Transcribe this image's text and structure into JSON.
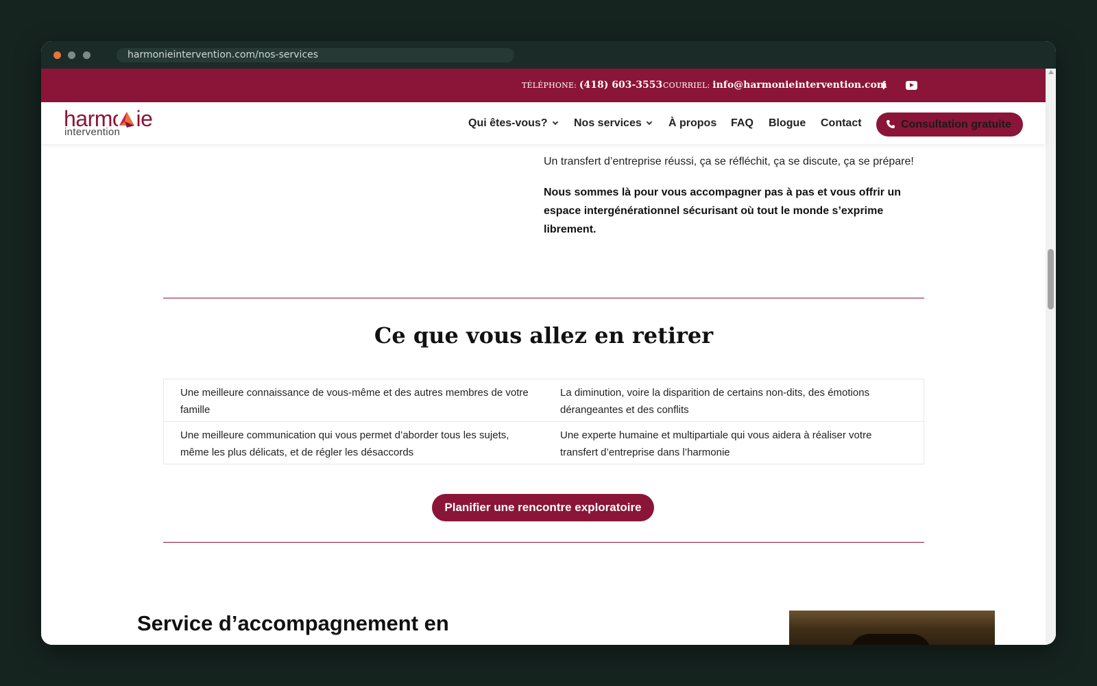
{
  "browser": {
    "url": "harmonieintervention.com/nos-services"
  },
  "topbar": {
    "phone_label": "TÉLÉPHONE:",
    "phone_value": "(418) 603-3553",
    "email_label": "COURRIEL:",
    "email_value": "info@harmonieintervention.com",
    "social_icons": [
      "facebook-icon",
      "youtube-icon"
    ]
  },
  "header": {
    "logo_top": "harmonie",
    "logo_bottom": "intervention",
    "nav": [
      {
        "label": "Qui êtes-vous?",
        "has_dropdown": true
      },
      {
        "label": "Nos services",
        "has_dropdown": true
      },
      {
        "label": "À propos",
        "has_dropdown": false
      },
      {
        "label": "FAQ",
        "has_dropdown": false
      },
      {
        "label": "Blogue",
        "has_dropdown": false
      },
      {
        "label": "Contact",
        "has_dropdown": false
      }
    ],
    "cta_label": "Consultation gratuite"
  },
  "content": {
    "intro": "Un transfert d’entreprise réussi, ça se réfléchit, ça se discute, ça se prépare!",
    "intro_bold": "Nous sommes là pour vous accompagner pas à pas et vous offrir un espace intergénérationnel sécurisant où tout le monde s’exprime librement.",
    "section_title": "Ce que vous allez en retirer",
    "benefits": [
      [
        "Une meilleure connaissance de vous-même et des autres membres de votre famille",
        "La diminution, voire la disparition de certains non-dits, des émotions dérangeantes et des conflits"
      ],
      [
        "Une meilleure communication qui vous permet d’aborder tous les sujets, même les plus délicats, et de régler les désaccords",
        "Une experte humaine et multipartiale qui vous aidera à réaliser votre transfert d’entreprise dans l’harmonie"
      ]
    ],
    "button_label": "Planifier une rencontre exploratoire",
    "next_heading": "Service d’accompagnement en"
  },
  "colors": {
    "brand": "#8a1538",
    "page_background": "#162420"
  }
}
